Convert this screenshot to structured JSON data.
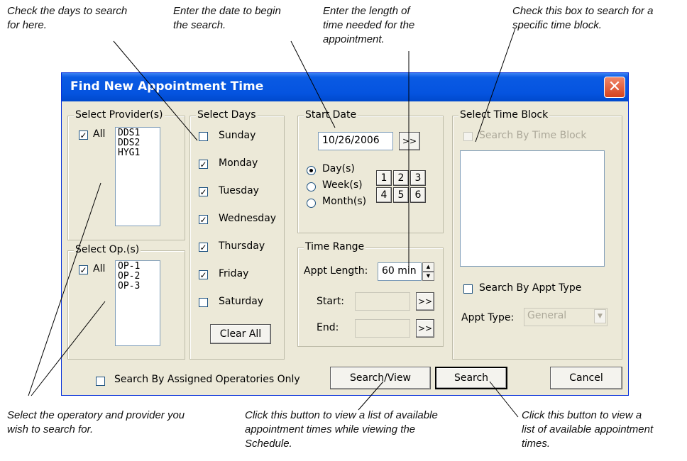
{
  "annotations": {
    "check_days": [
      "Check the days to search",
      "for here."
    ],
    "start_date": [
      "Enter the date to begin",
      "the search."
    ],
    "length": [
      "Enter the length of",
      "time needed for the",
      "appointment."
    ],
    "time_block": [
      "Check this box to search for a",
      "specific time block."
    ],
    "operatory_provider": [
      "Select the operatory and provider you",
      "wish to search for."
    ],
    "search_view": [
      "Click this button to view a list of available",
      "appointment times while viewing the",
      "Schedule."
    ],
    "search": [
      "Click this button to view a",
      "list of available appointment",
      "times."
    ]
  },
  "dialog": {
    "title": "Find New Appointment Time",
    "close_glyph": "✕"
  },
  "providers": {
    "legend": "Select Provider(s)",
    "all_label": "All",
    "all_checked": true,
    "items": [
      "DDS1",
      "DDS2",
      "HYG1"
    ]
  },
  "operatories": {
    "legend": "Select Op.(s)",
    "all_label": "All",
    "all_checked": true,
    "items": [
      "OP-1",
      "OP-2",
      "OP-3"
    ]
  },
  "days": {
    "legend": "Select Days",
    "items": [
      {
        "label": "Sunday",
        "checked": false
      },
      {
        "label": "Monday",
        "checked": true
      },
      {
        "label": "Tuesday",
        "checked": true
      },
      {
        "label": "Wednesday",
        "checked": true
      },
      {
        "label": "Thursday",
        "checked": true
      },
      {
        "label": "Friday",
        "checked": true
      },
      {
        "label": "Saturday",
        "checked": false
      }
    ],
    "clear_all": "Clear All"
  },
  "start_date": {
    "legend": "Start Date",
    "value": "10/26/2006",
    "arrow_button": ">>",
    "units": [
      "Day(s)",
      "Week(s)",
      "Month(s)"
    ],
    "selected_unit": "Day(s)",
    "numbers": [
      "1",
      "2",
      "3",
      "4",
      "5",
      "6"
    ]
  },
  "time_range": {
    "legend": "Time Range",
    "appt_length_label": "Appt Length:",
    "appt_length_value": "60 min",
    "start_label": "Start:",
    "end_label": "End:",
    "arrow_button": ">>",
    "spin_up": "▲",
    "spin_down": "▼"
  },
  "time_block": {
    "legend": "Select Time Block",
    "search_by_block": "Search By Time Block",
    "search_by_type": "Search By Appt Type",
    "appt_type_label": "Appt Type:",
    "appt_type_value": "General",
    "dropdown_glyph": "▼"
  },
  "footer": {
    "assigned_only": "Search By Assigned Operatories Only",
    "search_view": "Search/View",
    "search": "Search",
    "cancel": "Cancel"
  },
  "colors": {
    "titlebar": "#0554e0",
    "dialog_face": "#ece9d8",
    "close_button": "#d6421d"
  }
}
